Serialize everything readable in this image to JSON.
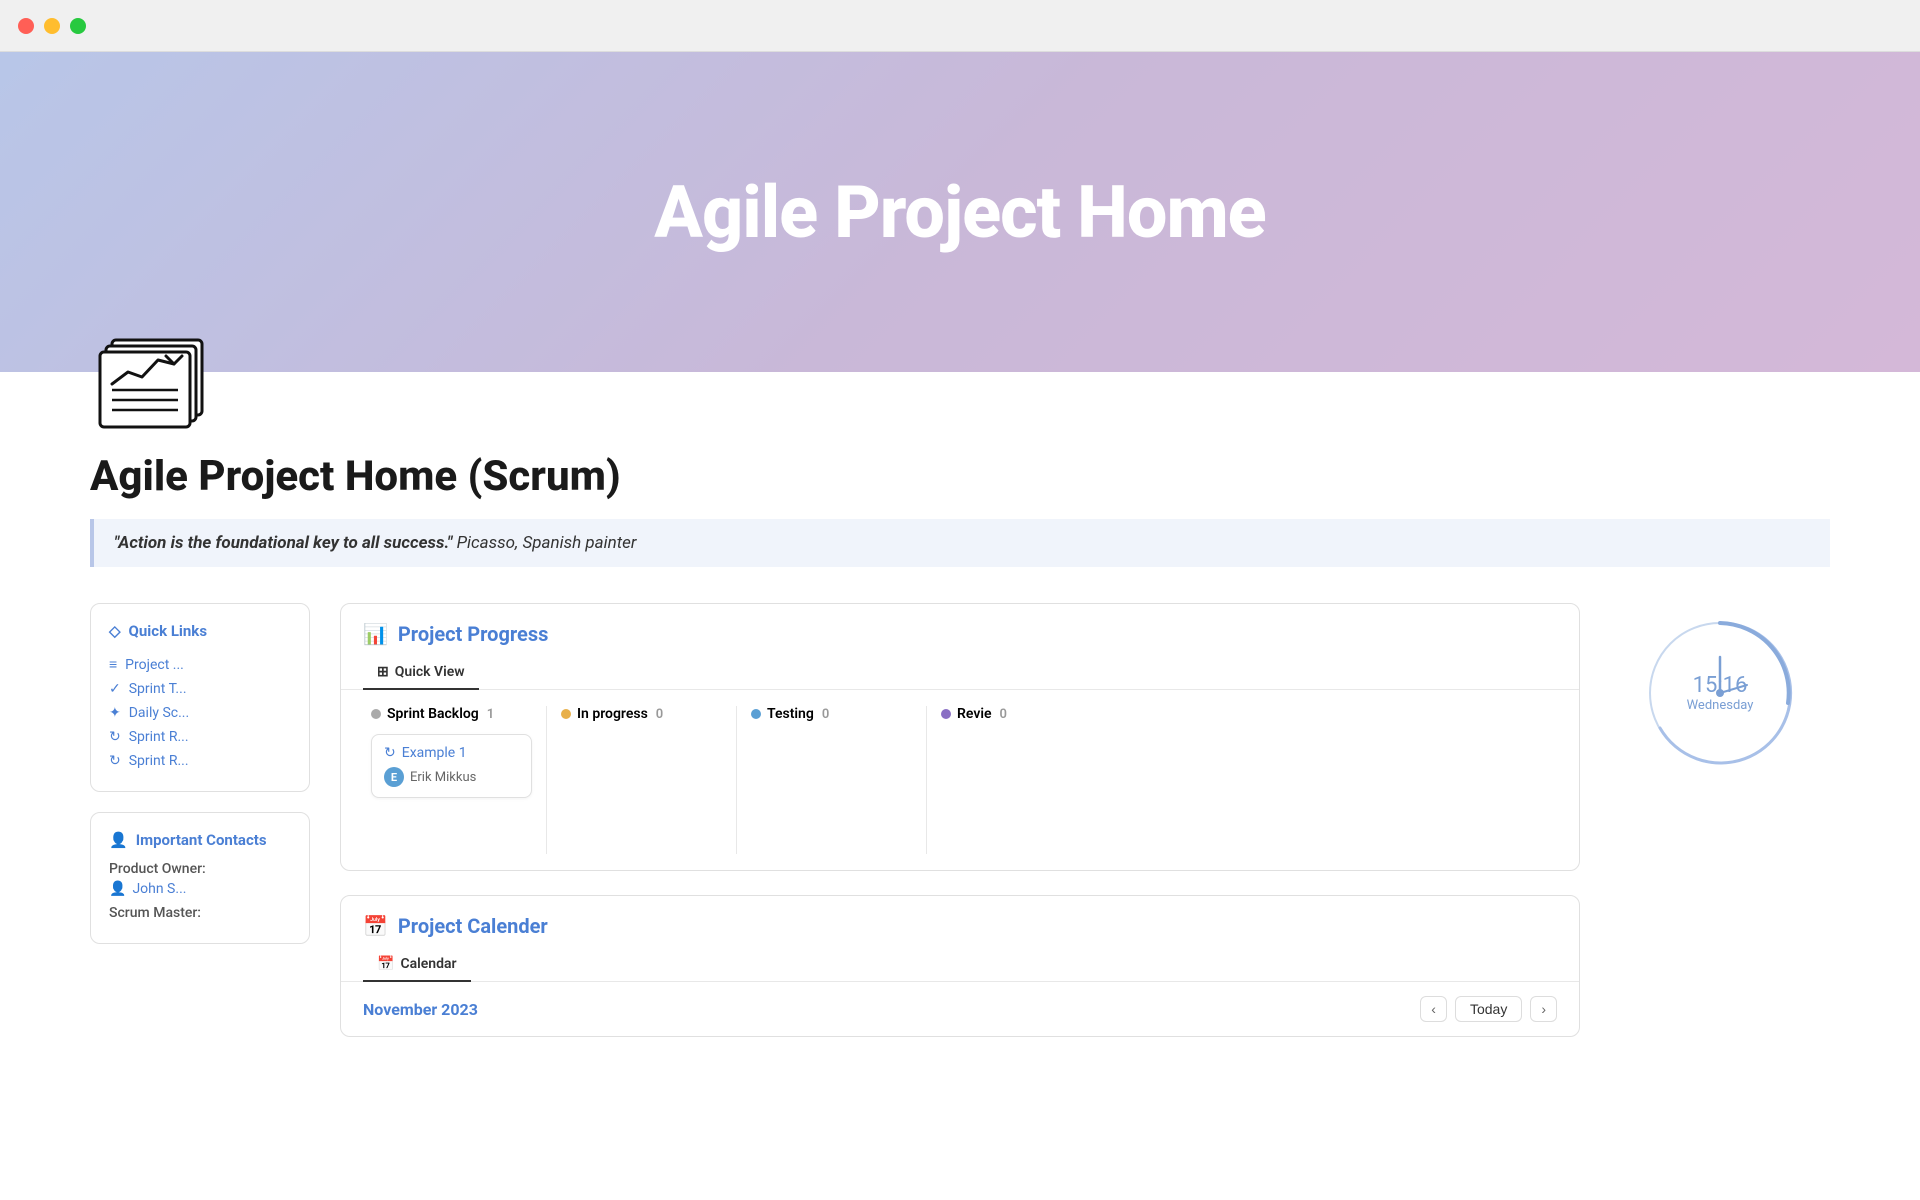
{
  "window": {
    "traffic_lights": [
      "red",
      "yellow",
      "green"
    ]
  },
  "hero": {
    "title": "Agile Project Home",
    "gradient_start": "#b8c6e8",
    "gradient_end": "#d4b8d8"
  },
  "page": {
    "title": "Agile Project Home (Scrum)",
    "quote_text": "\"Action is the foundational key to all success.\"",
    "quote_author": " Picasso, Spanish painter"
  },
  "quick_links": {
    "title": "Quick Links",
    "links": [
      {
        "label": "Project ...",
        "icon": "list-icon"
      },
      {
        "label": "Sprint T...",
        "icon": "check-icon"
      },
      {
        "label": "Daily Sc...",
        "icon": "sparkle-icon"
      },
      {
        "label": "Sprint R...",
        "icon": "refresh-icon"
      },
      {
        "label": "Sprint R...",
        "icon": "refresh-icon-2"
      }
    ]
  },
  "important_contacts": {
    "title": "Important Contacts",
    "product_owner_label": "Product Owner:",
    "product_owner_name": "John S...",
    "scrum_master_label": "Scrum Master:"
  },
  "project_progress": {
    "title": "Project Progress",
    "active_tab": "Quick View",
    "tabs": [
      "Quick View"
    ],
    "columns": [
      {
        "label": "Sprint Backlog",
        "count": 1,
        "dot": "gray"
      },
      {
        "label": "In progress",
        "count": 0,
        "dot": "yellow"
      },
      {
        "label": "Testing",
        "count": 0,
        "dot": "blue"
      },
      {
        "label": "Revie",
        "count": 0,
        "dot": "purple"
      }
    ],
    "cards": [
      {
        "column": 0,
        "title": "Example 1",
        "author": "Erik Mikkus",
        "avatar": "E"
      }
    ]
  },
  "clock": {
    "time": "15:16",
    "day": "Wednesday"
  },
  "project_calendar": {
    "title": "Project Calender",
    "active_tab": "Calendar",
    "tabs": [
      "Calendar"
    ],
    "month": "November 2023",
    "today_label": "Today"
  }
}
